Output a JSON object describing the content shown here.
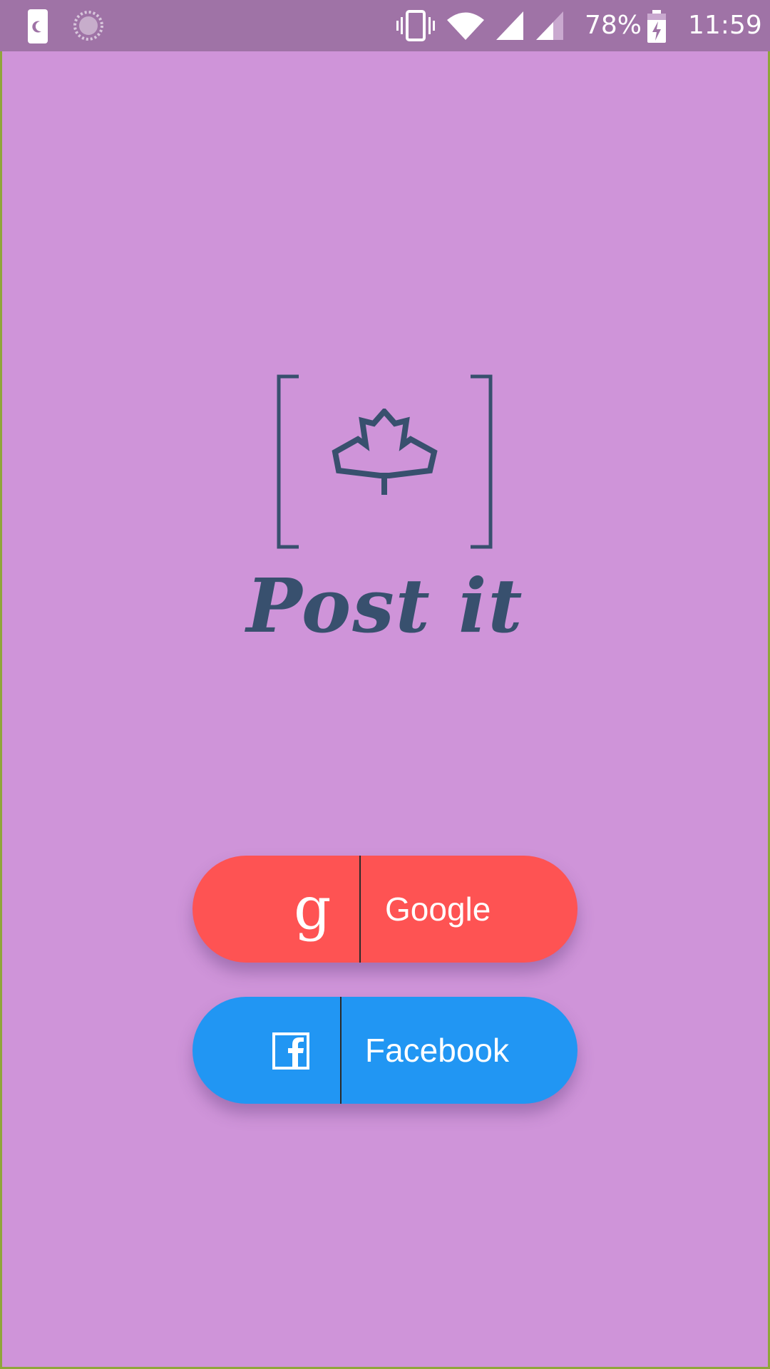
{
  "status_bar": {
    "battery_percent": "78%",
    "time": "11:59",
    "icons": [
      "dnd-moon-icon",
      "loading-spinner-icon",
      "vibrate-icon",
      "wifi-icon",
      "signal-icon",
      "signal-secondary-icon",
      "battery-charging-icon"
    ]
  },
  "logo": {
    "icon": "maple-leaf-icon",
    "title": "Post it"
  },
  "login": {
    "google_label": "Google",
    "google_icon": "google-g-icon",
    "facebook_label": "Facebook",
    "facebook_icon": "facebook-icon"
  },
  "colors": {
    "background": "#cf94d9",
    "status_bar": "#9f73a6",
    "google_button": "#fe5353",
    "facebook_button": "#2196f3",
    "logo": "#38506e"
  }
}
